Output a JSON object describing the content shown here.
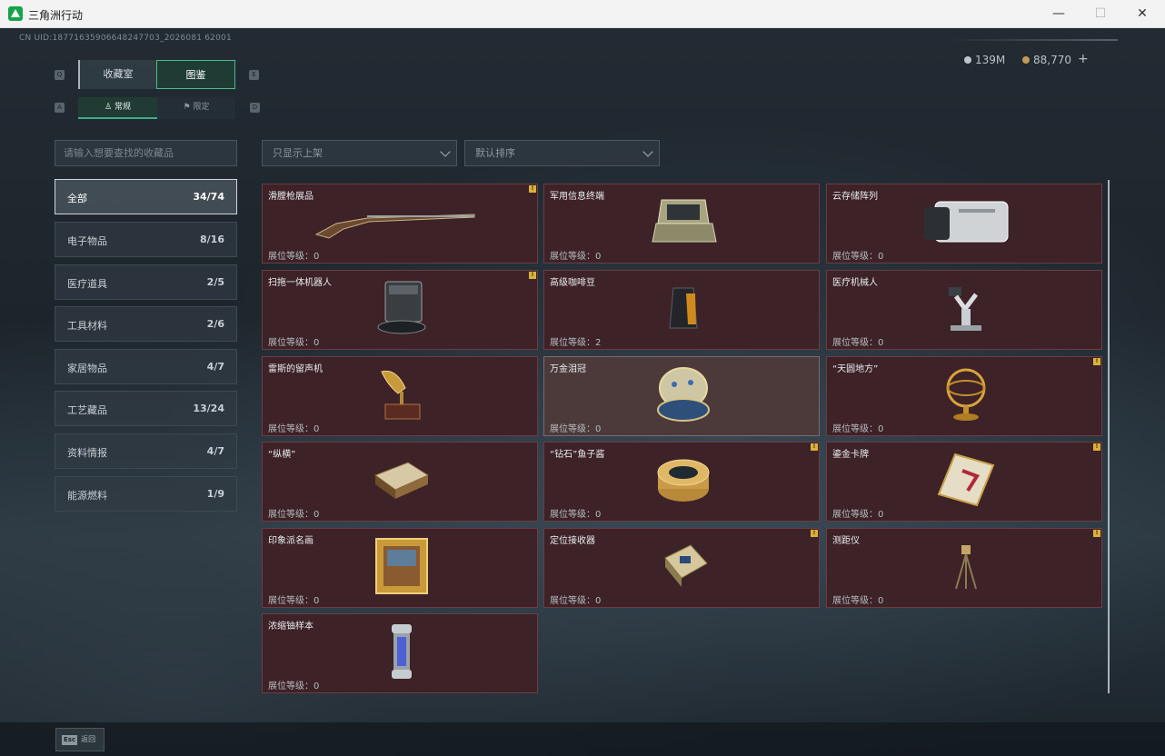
{
  "window": {
    "title": "三角洲行动",
    "minimize": "—",
    "maximize": "☐",
    "close": "✕"
  },
  "header": {
    "uid": "CN UID:18771635906648247703_2026081 62001",
    "currency_silver": "139M",
    "currency_gold": "88,770",
    "add": "+"
  },
  "tabs": {
    "collection": "收藏室",
    "atlas": "图鉴",
    "key_left": "Q",
    "key_right": "E",
    "sub_normal": "常规",
    "sub_limited": "限定",
    "sub_key_left": "A",
    "sub_key_right": "D"
  },
  "search": {
    "placeholder": "请输入想要查找的收藏品"
  },
  "filters": {
    "show": "只显示上架",
    "sort": "默认排序"
  },
  "categories": [
    {
      "label": "全部",
      "count": "34/74"
    },
    {
      "label": "电子物品",
      "count": "8/16"
    },
    {
      "label": "医疗道具",
      "count": "2/5"
    },
    {
      "label": "工具材料",
      "count": "2/6"
    },
    {
      "label": "家居物品",
      "count": "4/7"
    },
    {
      "label": "工艺藏品",
      "count": "13/24"
    },
    {
      "label": "资料情报",
      "count": "4/7"
    },
    {
      "label": "能源燃料",
      "count": "1/9"
    }
  ],
  "items": [
    {
      "name": "滑膛枪展品",
      "level": "展位等级：0",
      "badge": "!"
    },
    {
      "name": "军用信息终端",
      "level": "展位等级：0"
    },
    {
      "name": "云存储阵列",
      "level": "展位等级：0"
    },
    {
      "name": "扫拖一体机器人",
      "level": "展位等级：0",
      "badge": "!"
    },
    {
      "name": "高级咖啡豆",
      "level": "展位等级：2"
    },
    {
      "name": "医疗机械人",
      "level": "展位等级：0"
    },
    {
      "name": "雷斯的留声机",
      "level": "展位等级：0"
    },
    {
      "name": "万金泪冠",
      "level": "展位等级：0"
    },
    {
      "name": "“天圆地方”",
      "level": "展位等级：0",
      "badge": "!"
    },
    {
      "name": "“纵横”",
      "level": "展位等级：0"
    },
    {
      "name": "“钻石”鱼子酱",
      "level": "展位等级：0",
      "badge": "!"
    },
    {
      "name": "鎏金卡牌",
      "level": "展位等级：0",
      "badge": "!"
    },
    {
      "name": "印象派名画",
      "level": "展位等级：0"
    },
    {
      "name": "定位接收器",
      "level": "展位等级：0",
      "badge": "!"
    },
    {
      "name": "测距仪",
      "level": "展位等级：0",
      "badge": "!"
    },
    {
      "name": "浓缩铀样本",
      "level": "展位等级：0"
    }
  ],
  "footer": {
    "esc_key": "Esc",
    "back": "返回"
  }
}
